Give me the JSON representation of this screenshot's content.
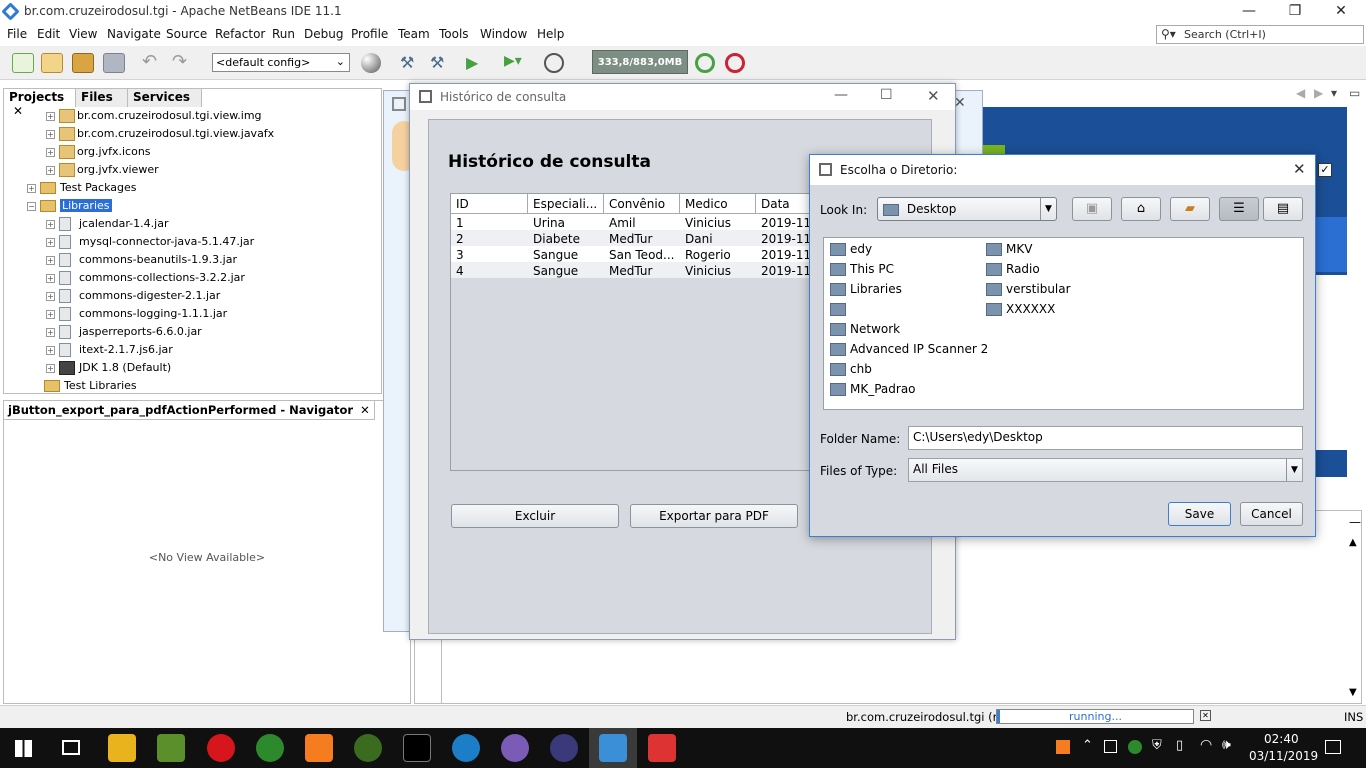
{
  "ide": {
    "title": "br.com.cruzeirodosul.tgi - Apache NetBeans IDE 11.1",
    "window_controls": {
      "minimize": "—",
      "restore": "❐",
      "close": "✕"
    },
    "menu": [
      "File",
      "Edit",
      "View",
      "Navigate",
      "Source",
      "Refactor",
      "Run",
      "Debug",
      "Profile",
      "Team",
      "Tools",
      "Window",
      "Help"
    ],
    "search_placeholder": "Search (Ctrl+I)",
    "config": "<default config>",
    "memory": "333,8/883,0MB"
  },
  "projects_panel": {
    "tabs": [
      "Projects",
      "Files",
      "Services"
    ],
    "tree": [
      {
        "label": "br.com.cruzeirodosul.tgi.view.img",
        "kind": "package"
      },
      {
        "label": "br.com.cruzeirodosul.tgi.view.javafx",
        "kind": "package"
      },
      {
        "label": "org.jvfx.icons",
        "kind": "package"
      },
      {
        "label": "org.jvfx.viewer",
        "kind": "package"
      },
      {
        "label": "Test Packages",
        "kind": "folder"
      },
      {
        "label": "Libraries",
        "kind": "folder",
        "selected": true
      },
      {
        "label": "jcalendar-1.4.jar",
        "kind": "jar"
      },
      {
        "label": "mysql-connector-java-5.1.47.jar",
        "kind": "jar"
      },
      {
        "label": "commons-beanutils-1.9.3.jar",
        "kind": "jar"
      },
      {
        "label": "commons-collections-3.2.2.jar",
        "kind": "jar"
      },
      {
        "label": "commons-digester-2.1.jar",
        "kind": "jar"
      },
      {
        "label": "commons-logging-1.1.1.jar",
        "kind": "jar"
      },
      {
        "label": "jasperreports-6.6.0.jar",
        "kind": "jar"
      },
      {
        "label": "itext-2.1.7.js6.jar",
        "kind": "jar"
      },
      {
        "label": "JDK 1.8 (Default)",
        "kind": "jdk"
      },
      {
        "label": "Test Libraries",
        "kind": "folder"
      }
    ]
  },
  "navigator_panel": {
    "tab": "jButton_export_para_pdfActionPerformed - Navigator",
    "empty": "<No View Available>"
  },
  "historico_window": {
    "title": "Histórico de consulta",
    "heading": "Histórico de consulta",
    "columns": [
      "ID",
      "Especiali...",
      "Convênio",
      "Medico",
      "Data"
    ],
    "rows": [
      [
        "1",
        "Urina",
        "Amil",
        "Vinicius",
        "2019-11-"
      ],
      [
        "2",
        "Diabete",
        "MedTur",
        "Dani",
        "2019-11-"
      ],
      [
        "3",
        "Sangue",
        "San Teod...",
        "Rogerio",
        "2019-11-"
      ],
      [
        "4",
        "Sangue",
        "MedTur",
        "Vinicius",
        "2019-11-"
      ]
    ],
    "btn_delete": "Excluir",
    "btn_export": "Exportar para PDF"
  },
  "dir_dialog": {
    "title": "Escolha o Diretorio:",
    "look_in_label": "Look In:",
    "look_in_value": "Desktop",
    "files_col1": [
      "edy",
      "This PC",
      "Libraries",
      "",
      "Network",
      "Advanced IP Scanner 2",
      "chb",
      "MK_Padrao"
    ],
    "files_col2": [
      "MKV",
      "Radio",
      "verstibular",
      "XXXXXX"
    ],
    "folder_name_label": "Folder Name:",
    "folder_name_value": "C:\\Users\\edy\\Desktop",
    "files_type_label": "Files of Type:",
    "files_type_value": "All Files",
    "btn_save": "Save",
    "btn_cancel": "Cancel"
  },
  "statusbar": {
    "project": "br.com.cruzeirodosul.tgi (run)",
    "progress_text": "running...",
    "mode": "INS"
  },
  "taskbar": {
    "time": "02:40",
    "date": "03/11/2019"
  }
}
